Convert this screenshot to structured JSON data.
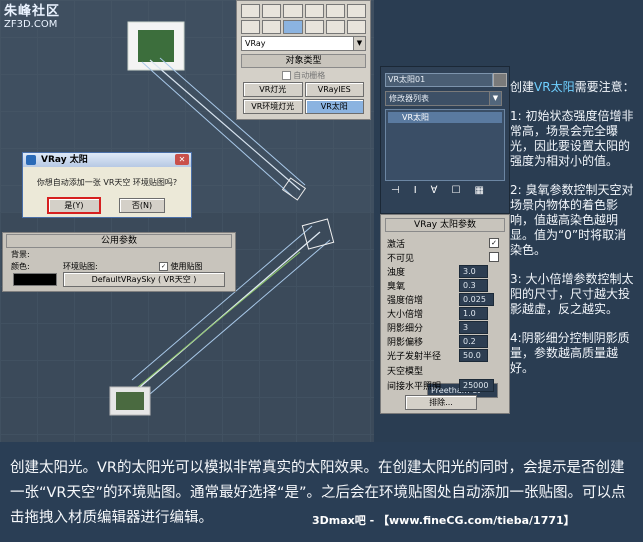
{
  "logo": {
    "name": "朱峰社区",
    "url": "ZF3D.COM"
  },
  "create_panel": {
    "renderer_select": "VRay",
    "rollout_title": "对象类型",
    "autogrid_label": "自动栅格",
    "buttons": [
      {
        "label": "VR灯光",
        "active": false
      },
      {
        "label": "VRayIES",
        "active": false
      },
      {
        "label": "VR环境灯光",
        "active": false
      },
      {
        "label": "VR太阳",
        "active": true
      }
    ]
  },
  "dialog": {
    "title": "VRay 太阳",
    "message": "你想自动添加一张 VR天空 环境贴图吗?",
    "yes_label": "是(Y)",
    "no_label": "否(N)",
    "close_icon": "close-icon"
  },
  "common_params": {
    "title": "公用参数",
    "background_label": "背景:",
    "color_label": "颜色:",
    "color": "#000000",
    "envmap_label": "环境贴图:",
    "use_map_label": "使用贴图",
    "use_map_checked": true,
    "map_button": "DefaultVRaySky  ( VR天空 )"
  },
  "modify_panel": {
    "object_name": "VR太阳01",
    "modifier_list": "修改器列表",
    "stack_item": "VR太阳"
  },
  "sun_params": {
    "title": "VRay 太阳参数",
    "rows": [
      {
        "label": "激活",
        "value": "",
        "type": "check",
        "checked": true
      },
      {
        "label": "不可见",
        "value": "",
        "type": "check",
        "checked": false
      },
      {
        "label": "浊度",
        "value": "3.0",
        "type": "spin"
      },
      {
        "label": "臭氧",
        "value": "0.3",
        "type": "spin"
      },
      {
        "label": "强度倍增",
        "value": "0.025",
        "type": "spin"
      },
      {
        "label": "大小倍增",
        "value": "1.0",
        "type": "spin"
      },
      {
        "label": "阴影细分",
        "value": "3",
        "type": "spin"
      },
      {
        "label": "阴影偏移",
        "value": "0.2",
        "type": "spin"
      },
      {
        "label": "光子发射半径",
        "value": "50.0",
        "type": "spin"
      }
    ],
    "sky_model_label": "天空模型",
    "sky_model_value": "Preetham et",
    "indirect_label": "间接水平照明",
    "indirect_value": "25000",
    "exclude_label": "排除..."
  },
  "right_notes": {
    "title_prefix": "创建",
    "title_highlight": "VR太阳",
    "title_suffix": "需要注意：",
    "note1": "1: 初始状态强度倍增非常高，场景会完全曝光，因此要设置太阳的强度为相对小的值。",
    "note2": "2: 臭氧参数控制天空对场景内物体的着色影响，值越高染色越明显。值为“0”时将取消染色。",
    "note3": "3: 大小倍增参数控制太阳的尺寸，尺寸越大投影越虚，反之越实。",
    "note4": "4:阴影细分控制阴影质量，参数越高质量越好。"
  },
  "caption": "创建太阳光。VR的太阳光可以模拟非常真实的太阳效果。在创建太阳光的同时，会提示是否创建一张“VR天空”的环境贴图。通常最好选择“是”。之后会在环境贴图处自动添加一张贴图。可以点击拖拽入材质编辑器进行编辑。",
  "watermark": "3Dmax吧 - 【www.fineCG.com/tieba/1771】"
}
